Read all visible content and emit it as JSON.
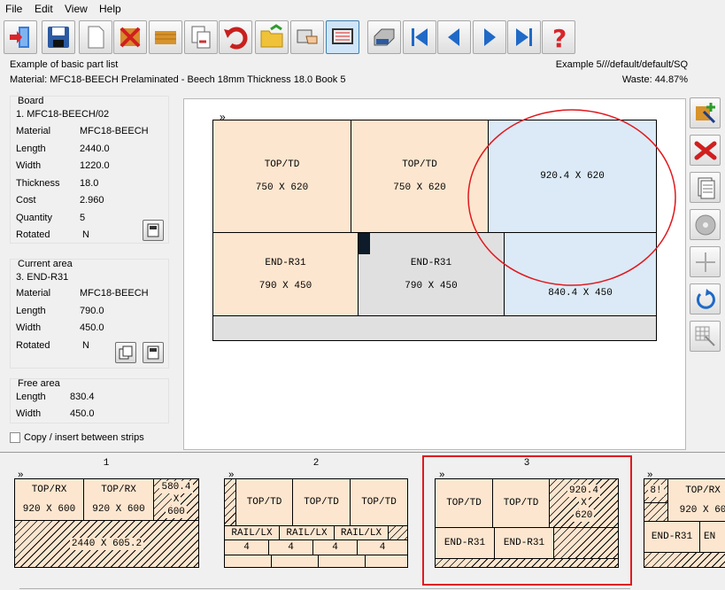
{
  "menu": [
    "File",
    "Edit",
    "View",
    "Help"
  ],
  "toolbar": {
    "icons": [
      "exit-icon",
      "save-icon",
      "new-icon",
      "delete-board-icon",
      "board-icon",
      "copy-icon",
      "undo-icon",
      "open-folder-icon",
      "hand-pointer-icon",
      "display-icon",
      "printer-icon",
      "first-icon",
      "previous-icon",
      "next-icon",
      "last-icon",
      "help-icon"
    ]
  },
  "header": {
    "title": "Example of basic part list",
    "right_title": "Example 5///default/default/SQ",
    "material_line": "Material: MFC18-BEECH Prelaminated - Beech 18mm Thickness  18.0 Book 5",
    "waste": "Waste: 44.87%"
  },
  "board": {
    "title": "Board",
    "name": "1. MFC18-BEECH/02",
    "rows": [
      {
        "label": "Material",
        "value": "MFC18-BEECH"
      },
      {
        "label": "Length",
        "value": "2440.0"
      },
      {
        "label": "Width",
        "value": "1220.0"
      },
      {
        "label": "Thickness",
        "value": "18.0"
      },
      {
        "label": "Cost",
        "value": "2.960"
      },
      {
        "label": "Quantity",
        "value": "5"
      },
      {
        "label": "Rotated",
        "value": "N"
      }
    ]
  },
  "current": {
    "title": "Current area",
    "name": "3. END-R31",
    "rows": [
      {
        "label": "Material",
        "value": "MFC18-BEECH"
      },
      {
        "label": "Length",
        "value": "790.0"
      },
      {
        "label": "Width",
        "value": "450.0"
      },
      {
        "label": "Rotated",
        "value": "N"
      }
    ]
  },
  "free": {
    "title": "Free area",
    "rows": [
      {
        "label": "Length",
        "value": "830.4"
      },
      {
        "label": "Width",
        "value": "450.0"
      }
    ]
  },
  "copy_checkbox": "Copy / insert between strips",
  "main": {
    "marker": "»",
    "pieces": [
      {
        "name": "TOP/TD",
        "size": "750 X 620"
      },
      {
        "name": "TOP/TD",
        "size": "750 X 620"
      },
      {
        "name": "",
        "size": "920.4 X 620"
      },
      {
        "name": "END-R31",
        "size": "790 X 450"
      },
      {
        "name": "END-R31",
        "size": "790 X 450"
      },
      {
        "name": "",
        "size": "840.4 X 450"
      }
    ]
  },
  "thumbs": [
    {
      "num": "1",
      "pieces": [
        "TOP/RX",
        "920 X 600",
        "TOP/RX",
        "920 X 600",
        "580.4",
        "X",
        "600",
        "2440 X 605.2"
      ]
    },
    {
      "num": "2",
      "pieces": [
        "TOP/TD",
        "TOP/TD",
        "TOP/TD",
        "RAIL/LX",
        "RAIL/LX",
        "RAIL/LX",
        "4",
        "4",
        "4",
        "4"
      ]
    },
    {
      "num": "3",
      "pieces": [
        "TOP/TD",
        "TOP/TD",
        "920.4",
        "X",
        "620",
        "END-R31",
        "END-R31"
      ]
    },
    {
      "num": "",
      "pieces": [
        "8!",
        "TOP/RX",
        "920 X 60",
        "END-R31",
        "EN"
      ]
    }
  ],
  "colors": {
    "highlight": "#e0191e",
    "wood": "#fde6cf",
    "free": "#dbeaf6"
  }
}
